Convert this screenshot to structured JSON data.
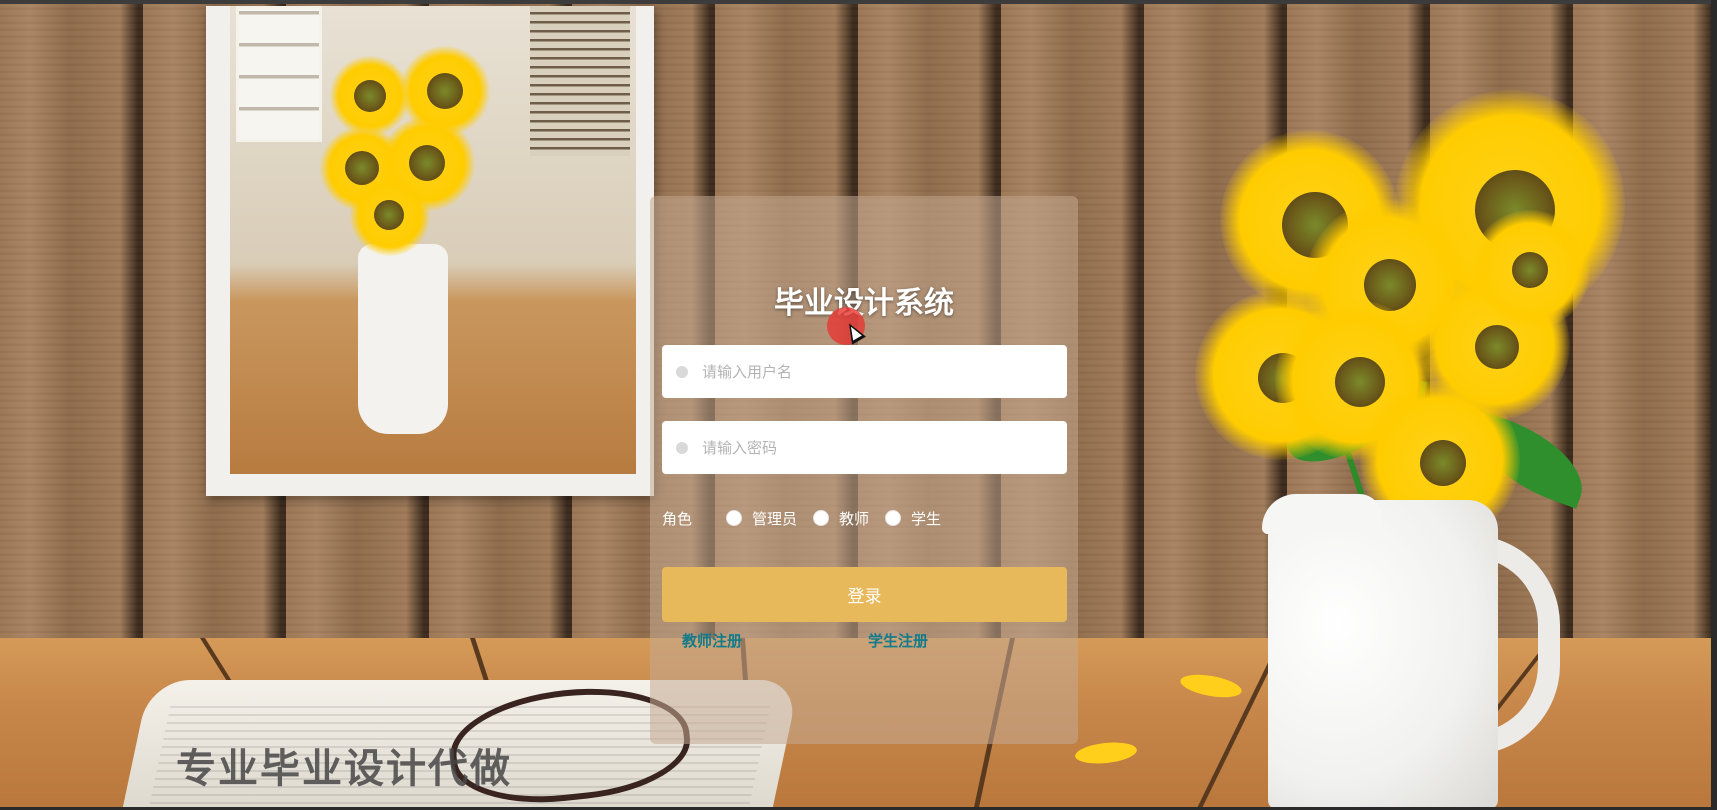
{
  "login": {
    "title": "毕业设计系统",
    "username_placeholder": "请输入用户名",
    "password_placeholder": "请输入密码",
    "role_label": "角色",
    "roles": [
      "管理员",
      "教师",
      "学生"
    ],
    "login_button": "登录",
    "teacher_register": "教师注册",
    "student_register": "学生注册"
  },
  "watermark": "专业毕业设计代做",
  "icons": [
    "user-icon",
    "lock-icon",
    "mouse-cursor-icon"
  ],
  "colors": {
    "login_button": "#e8b95a",
    "link": "#117a8b",
    "title": "#ffffff"
  }
}
